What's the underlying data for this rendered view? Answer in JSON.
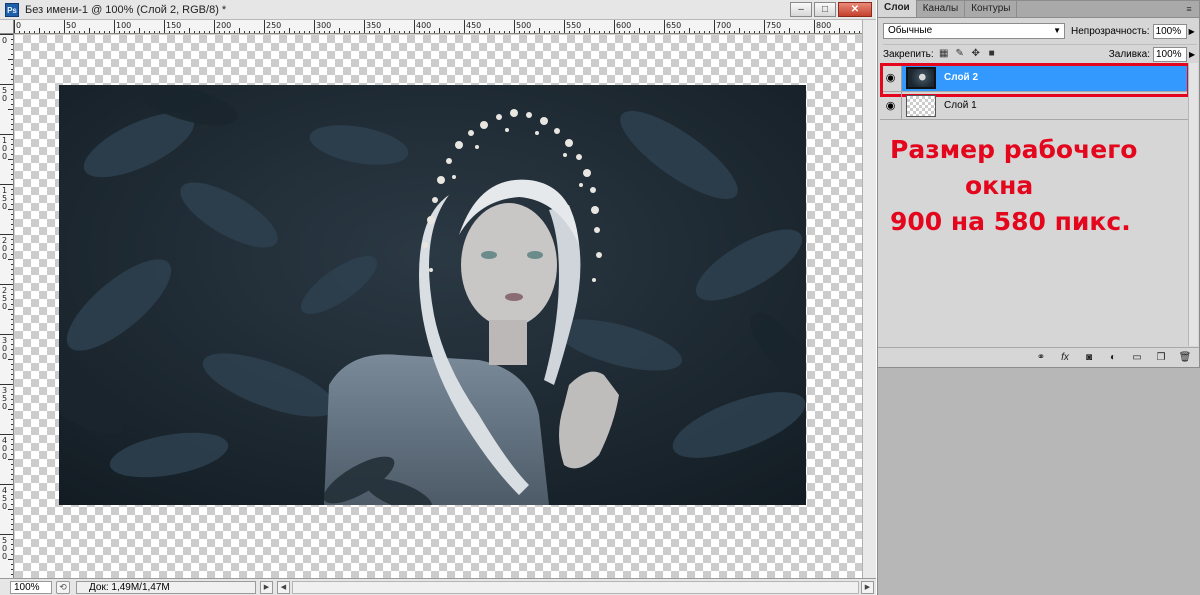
{
  "document": {
    "title": "Без имени-1 @ 100% (Слой 2, RGB/8) *",
    "app_icon": "Ps",
    "window_buttons": {
      "minimize": "–",
      "maximize": "□",
      "close": "✕"
    },
    "ruler_h_labels": [
      "0",
      "50",
      "100",
      "150",
      "200",
      "250",
      "300",
      "350",
      "400",
      "450",
      "500",
      "550",
      "600",
      "650",
      "700",
      "750",
      "800"
    ],
    "ruler_v_labels": [
      "0",
      "50",
      "100",
      "150",
      "200",
      "250",
      "300",
      "350",
      "400",
      "450",
      "500"
    ],
    "photo_description_icon": "photo-image",
    "status": {
      "zoom": "100%",
      "doc_size": "Док: 1,49M/1,47M"
    }
  },
  "layers_panel": {
    "tabs": [
      "Слои",
      "Каналы",
      "Контуры"
    ],
    "active_tab": 0,
    "blend_mode": "Обычные",
    "opacity_label": "Непрозрачность:",
    "opacity_value": "100%",
    "lock_label": "Закрепить:",
    "fill_label": "Заливка:",
    "fill_value": "100%",
    "layers": [
      {
        "name": "Слой 2",
        "selected": true,
        "thumb": "image"
      },
      {
        "name": "Слой 1",
        "selected": false,
        "thumb": "transparent"
      }
    ],
    "annotation": [
      "Размер рабочего",
      "окна",
      "900 на 580 пикс."
    ],
    "colors": {
      "selection": "#3399ff",
      "annotation": "#e3061c"
    }
  }
}
